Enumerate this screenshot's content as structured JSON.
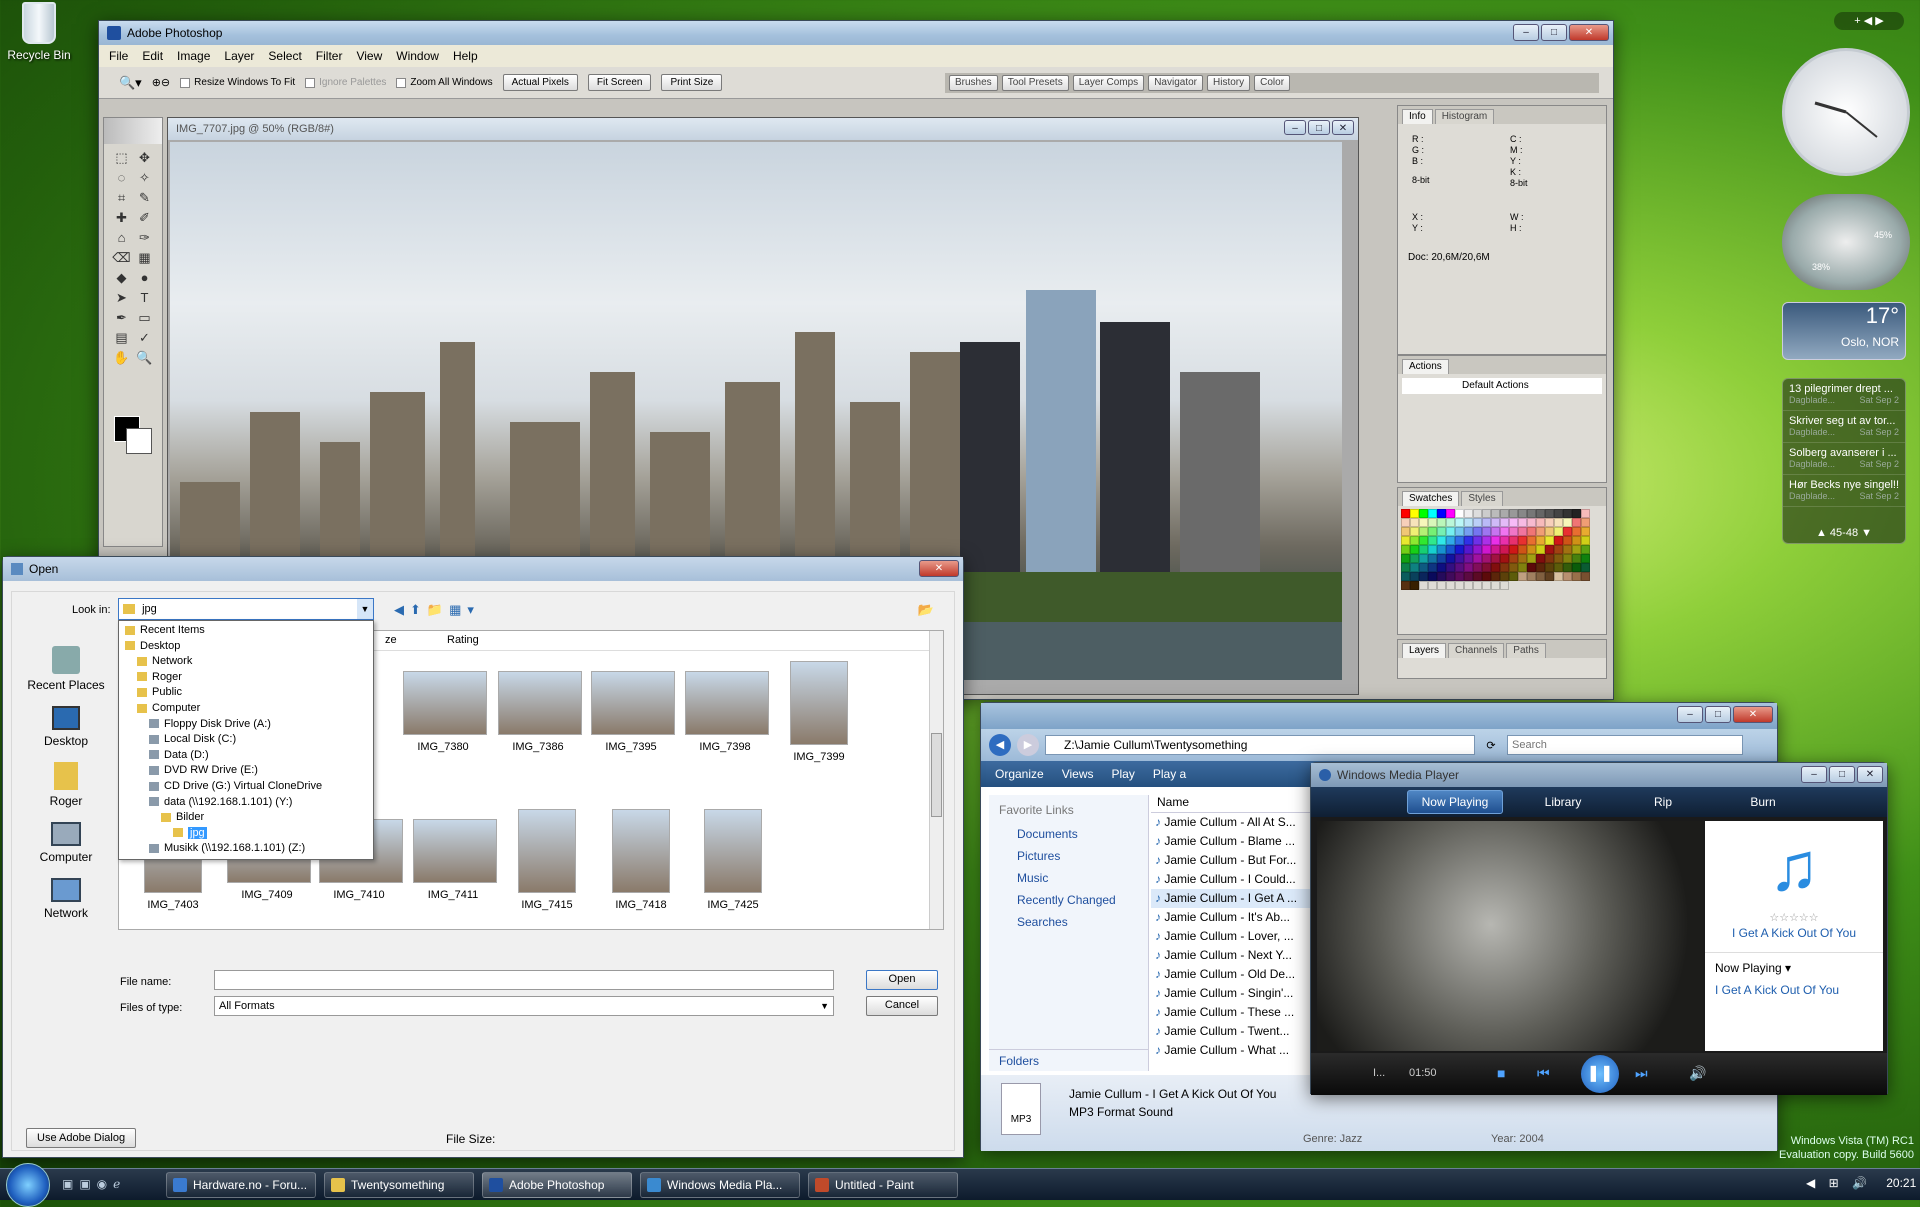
{
  "desktop": {
    "recycle_bin": "Recycle Bin"
  },
  "photoshop": {
    "title": "Adobe Photoshop",
    "menu": [
      "File",
      "Edit",
      "Image",
      "Layer",
      "Select",
      "Filter",
      "View",
      "Window",
      "Help"
    ],
    "options": {
      "resize": "Resize Windows To Fit",
      "ignore": "Ignore Palettes",
      "zoom_all": "Zoom All Windows",
      "actual": "Actual Pixels",
      "fit": "Fit Screen",
      "print": "Print Size"
    },
    "palette_well": [
      "Brushes",
      "Tool Presets",
      "Layer Comps",
      "Navigator",
      "History",
      "Color"
    ],
    "doc_title": "IMG_7707.jpg @ 50% (RGB/8#)",
    "info": {
      "tabs": [
        "Info",
        "Histogram"
      ],
      "rgb": [
        "R :",
        "G :",
        "B :"
      ],
      "cmyk": [
        "C :",
        "M :",
        "Y :",
        "K :"
      ],
      "bit_left": "8-bit",
      "bit_right": "8-bit",
      "xy": [
        "X :",
        "Y :"
      ],
      "wh": [
        "W :",
        "H :"
      ],
      "doc": "Doc: 20,6M/20,6M"
    },
    "actions": {
      "tab": "Actions",
      "item": "Default Actions"
    },
    "swatches": {
      "tabs": [
        "Swatches",
        "Styles"
      ]
    },
    "layers": {
      "tabs": [
        "Layers",
        "Channels",
        "Paths"
      ]
    }
  },
  "open_dialog": {
    "title": "Open",
    "look_in_label": "Look in:",
    "look_in_value": "jpg",
    "places": [
      "Recent Places",
      "Desktop",
      "Roger",
      "Computer",
      "Network"
    ],
    "dropdown": [
      "Recent Items",
      "Desktop",
      "Network",
      "Roger",
      "Public",
      "Computer",
      "Floppy Disk Drive (A:)",
      "Local Disk (C:)",
      "Data (D:)",
      "DVD RW Drive (E:)",
      "CD Drive (G:) Virtual CloneDrive",
      "data (\\\\192.168.1.101) (Y:)",
      "Bilder",
      "jpg",
      "Musikk (\\\\192.168.1.101) (Z:)"
    ],
    "columns": [
      "ze",
      "Rating"
    ],
    "thumbs_row1": [
      "IMG_7380",
      "IMG_7386",
      "IMG_7395",
      "IMG_7398",
      "IMG_7399"
    ],
    "thumbs_row2": [
      "IMG_7403",
      "IMG_7409",
      "IMG_7410",
      "IMG_7411",
      "IMG_7415",
      "IMG_7418",
      "IMG_7425"
    ],
    "file_name_label": "File name:",
    "file_name_value": "",
    "files_of_type_label": "Files of type:",
    "files_of_type_value": "All Formats",
    "open_btn": "Open",
    "cancel_btn": "Cancel",
    "adobe_btn": "Use Adobe Dialog",
    "file_size": "File Size:"
  },
  "explorer": {
    "path": "Z:\\Jamie Cullum\\Twentysomething",
    "search_placeholder": "Search",
    "toolbar": [
      "Organize",
      "Views",
      "Play",
      "Play a"
    ],
    "fav_header": "Favorite Links",
    "links": [
      "Documents",
      "Pictures",
      "Music",
      "Recently Changed",
      "Searches"
    ],
    "folders": "Folders",
    "col_name": "Name",
    "files": [
      "Jamie Cullum - All At S...",
      "Jamie Cullum - Blame ...",
      "Jamie Cullum - But For...",
      "Jamie Cullum - I Could...",
      "Jamie Cullum - I Get A ...",
      "Jamie Cullum - It's Ab...",
      "Jamie Cullum - Lover, ...",
      "Jamie Cullum - Next Y...",
      "Jamie Cullum - Old De...",
      "Jamie Cullum - Singin'...",
      "Jamie Cullum - These ...",
      "Jamie Cullum - Twent...",
      "Jamie Cullum - What ..."
    ],
    "detail_title": "Jamie Cullum - I Get A Kick Out Of You",
    "detail_type": "MP3 Format Sound",
    "detail_genre": "Genre: Jazz",
    "detail_year": "Year: 2004",
    "mp3_label": "MP3"
  },
  "wmp": {
    "title": "Windows Media Player",
    "tabs": [
      "Now Playing",
      "Library",
      "Rip",
      "Burn"
    ],
    "song": "I Get A Kick Out Of You",
    "now_playing_label": "Now Playing",
    "playlist_item": "I Get A Kick Out Of You",
    "time": "01:50",
    "status_short": "I..."
  },
  "gadgets": {
    "temp": "17°",
    "city": "Oslo, NOR",
    "cpu1": "38%",
    "cpu2": "45%",
    "news": [
      {
        "t": "13 pilegrimer drept ...",
        "s": "Dagblade...",
        "d": "Sat Sep 2"
      },
      {
        "t": "Skriver seg ut av tor...",
        "s": "Dagblade...",
        "d": "Sat Sep 2"
      },
      {
        "t": "Solberg avanserer i ...",
        "s": "Dagblade...",
        "d": "Sat Sep 2"
      },
      {
        "t": "Hør Becks nye singel!!",
        "s": "Dagblade...",
        "d": "Sat Sep 2"
      }
    ],
    "news_pager": "45-48"
  },
  "watermark": {
    "l1": "Windows Vista (TM) RC1",
    "l2": "Evaluation copy. Build 5600"
  },
  "taskbar": {
    "items": [
      "Hardware.no - Foru...",
      "Twentysomething",
      "Adobe Photoshop",
      "Windows Media Pla...",
      "Untitled - Paint"
    ],
    "clock": "20:21"
  },
  "colors": {
    "accent": "#1f5fbf",
    "vista_bar": "#0d1b2c"
  }
}
